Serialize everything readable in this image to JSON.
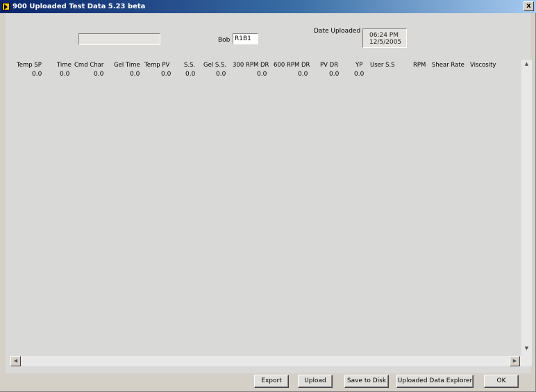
{
  "window": {
    "title": "900 Uploaded Test Data  5.23 beta",
    "close_glyph": "x"
  },
  "bob": {
    "label": "Bob",
    "value": "R1B1"
  },
  "date_uploaded": {
    "label": "Date Uploaded",
    "time": "06:24 PM",
    "date": "12/5/2005"
  },
  "table": {
    "columns": [
      "Temp SP",
      "Time",
      "Cmd Char",
      "Gel Time",
      "Temp PV",
      "S.S.",
      "Gel S.S.",
      "300 RPM DR",
      "600 RPM DR",
      "PV DR",
      "YP",
      "User S.S",
      "RPM",
      "Shear Rate",
      "Viscosity"
    ],
    "row": [
      "0.0",
      "0.0",
      "0.0",
      "0.0",
      "0.0",
      "0.0",
      "0.0",
      "0.0",
      "0.0",
      "0.0",
      "0.0"
    ]
  },
  "buttons": {
    "export": "Export",
    "upload": "Upload",
    "save": "Save to Disk",
    "explorer": "Uploaded Data Explorer",
    "ok": "OK"
  }
}
